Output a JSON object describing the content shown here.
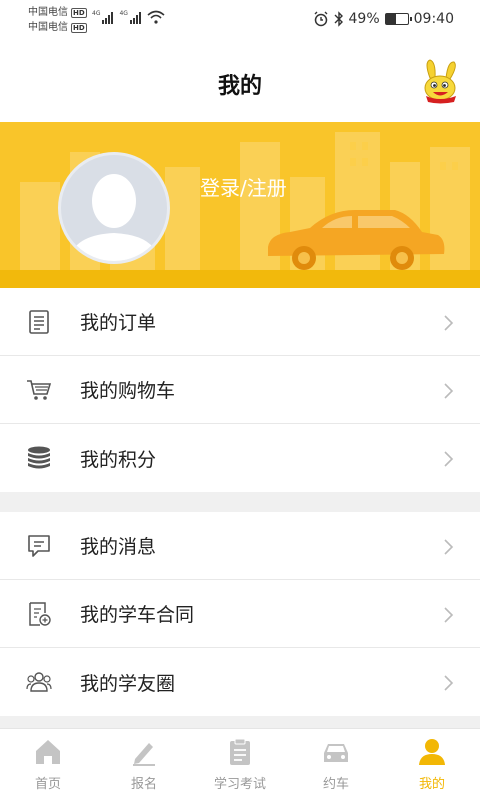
{
  "status_bar": {
    "carrier1": "中国电信",
    "carrier2": "中国电信",
    "hd": "HD",
    "net1": "4G",
    "net2": "4G",
    "battery": "49%",
    "battery_level": 0.49,
    "time": "09:40"
  },
  "header": {
    "title": "我的"
  },
  "profile": {
    "login_label": "登录/注册"
  },
  "menu_group_1": [
    {
      "label": "我的订单",
      "icon": "order-list-icon"
    },
    {
      "label": "我的购物车",
      "icon": "shopping-cart-icon"
    },
    {
      "label": "我的积分",
      "icon": "coins-stack-icon"
    }
  ],
  "menu_group_2": [
    {
      "label": "我的消息",
      "icon": "message-icon"
    },
    {
      "label": "我的学车合同",
      "icon": "contract-icon"
    },
    {
      "label": "我的学友圈",
      "icon": "friends-icon"
    }
  ],
  "tabs": [
    {
      "label": "首页",
      "icon": "home-icon",
      "active": false
    },
    {
      "label": "报名",
      "icon": "signup-pen-icon",
      "active": false
    },
    {
      "label": "学习考试",
      "icon": "study-exam-icon",
      "active": false
    },
    {
      "label": "约车",
      "icon": "car-icon",
      "active": false
    },
    {
      "label": "我的",
      "icon": "profile-icon",
      "active": true
    }
  ],
  "colors": {
    "brand_yellow": "#f9c52a",
    "active_tab": "#f2b705",
    "inactive_tab": "#c4c4c4"
  }
}
